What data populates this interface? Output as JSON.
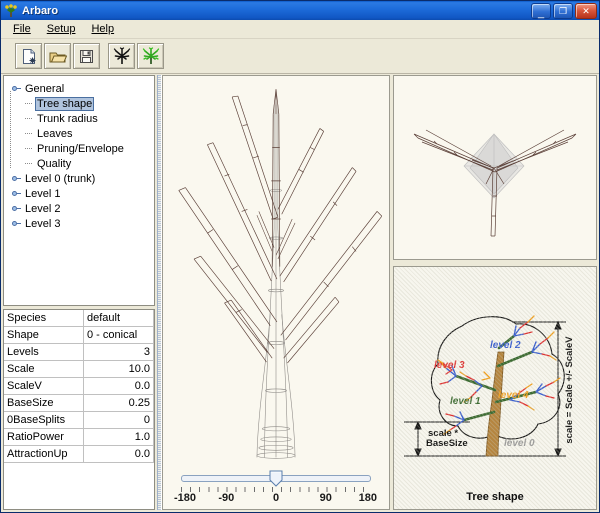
{
  "window": {
    "title": "Arbaro",
    "icon": "arbaro-tree-icon",
    "buttons": {
      "minimize": "minimize-button",
      "maximize": "maximize-button",
      "close": "close-button",
      "minimize_glyph": "_",
      "maximize_glyph": "❐",
      "close_glyph": "✕"
    }
  },
  "menubar": {
    "items": [
      {
        "label": "File",
        "mnemonic": "F"
      },
      {
        "label": "Setup",
        "mnemonic": "S"
      },
      {
        "label": "Help",
        "mnemonic": "H"
      }
    ]
  },
  "toolbar": {
    "buttons": [
      {
        "name": "new-file-button",
        "icon": "new-document-icon",
        "tooltip": "New"
      },
      {
        "name": "open-file-button",
        "icon": "open-folder-icon",
        "tooltip": "Open"
      },
      {
        "name": "save-file-button",
        "icon": "floppy-save-icon",
        "tooltip": "Save"
      },
      {
        "name": "render-wireframe-button",
        "icon": "black-tree-icon",
        "tooltip": "Render tree"
      },
      {
        "name": "render-shaded-button",
        "icon": "green-tree-icon",
        "tooltip": "Render leaves"
      }
    ]
  },
  "tree_view": {
    "root": {
      "label": "General",
      "expanded": true
    },
    "children": [
      {
        "label": "Tree shape",
        "selected": true
      },
      {
        "label": "Trunk radius",
        "selected": false
      },
      {
        "label": "Leaves",
        "selected": false
      },
      {
        "label": "Pruning/Envelope",
        "selected": false
      },
      {
        "label": "Quality",
        "selected": false
      }
    ],
    "levels": [
      {
        "label": "Level 0 (trunk)"
      },
      {
        "label": "Level 1"
      },
      {
        "label": "Level 2"
      },
      {
        "label": "Level 3"
      }
    ]
  },
  "properties": {
    "rows": [
      {
        "name": "Species",
        "value": "default",
        "align": "left"
      },
      {
        "name": "Shape",
        "value": "0 - conical",
        "align": "left"
      },
      {
        "name": "Levels",
        "value": "3",
        "align": "right"
      },
      {
        "name": "Scale",
        "value": "10.0",
        "align": "right"
      },
      {
        "name": "ScaleV",
        "value": "0.0",
        "align": "right"
      },
      {
        "name": "BaseSize",
        "value": "0.25",
        "align": "right"
      },
      {
        "name": "0BaseSplits",
        "value": "0",
        "align": "right"
      },
      {
        "name": "RatioPower",
        "value": "1.0",
        "align": "right"
      },
      {
        "name": "AttractionUp",
        "value": "0.0",
        "align": "right"
      }
    ]
  },
  "viewport": {
    "front_view": "tree-wireframe-front-view",
    "top_view": "tree-wireframe-top-view",
    "background_color": "#faf8ef",
    "wire_color": "#5b4038"
  },
  "rotation_slider": {
    "name": "rotation-slider",
    "value": "0",
    "min": "-180",
    "max": "180",
    "tick_labels": [
      "-180",
      "-90",
      "0",
      "90",
      "180"
    ]
  },
  "diagram": {
    "caption": "Tree shape",
    "labels": {
      "level0": "level 0",
      "level1": "level 1",
      "level2": "level 2",
      "level3": "level 3",
      "level4": "level 4",
      "basesize": "scale *\nBaseSize",
      "basesize_line1": "scale *",
      "basesize_line2": "BaseSize",
      "scale_axis": "scale = Scale +/- ScaleV"
    },
    "colors": {
      "level0": "#9a9a9a",
      "level1": "#3c7a3c",
      "level2": "#3a5fd0",
      "level3": "#e03232",
      "level4": "#f0a020",
      "trunk": "#b5853f",
      "branch": "#3c6b32"
    }
  }
}
